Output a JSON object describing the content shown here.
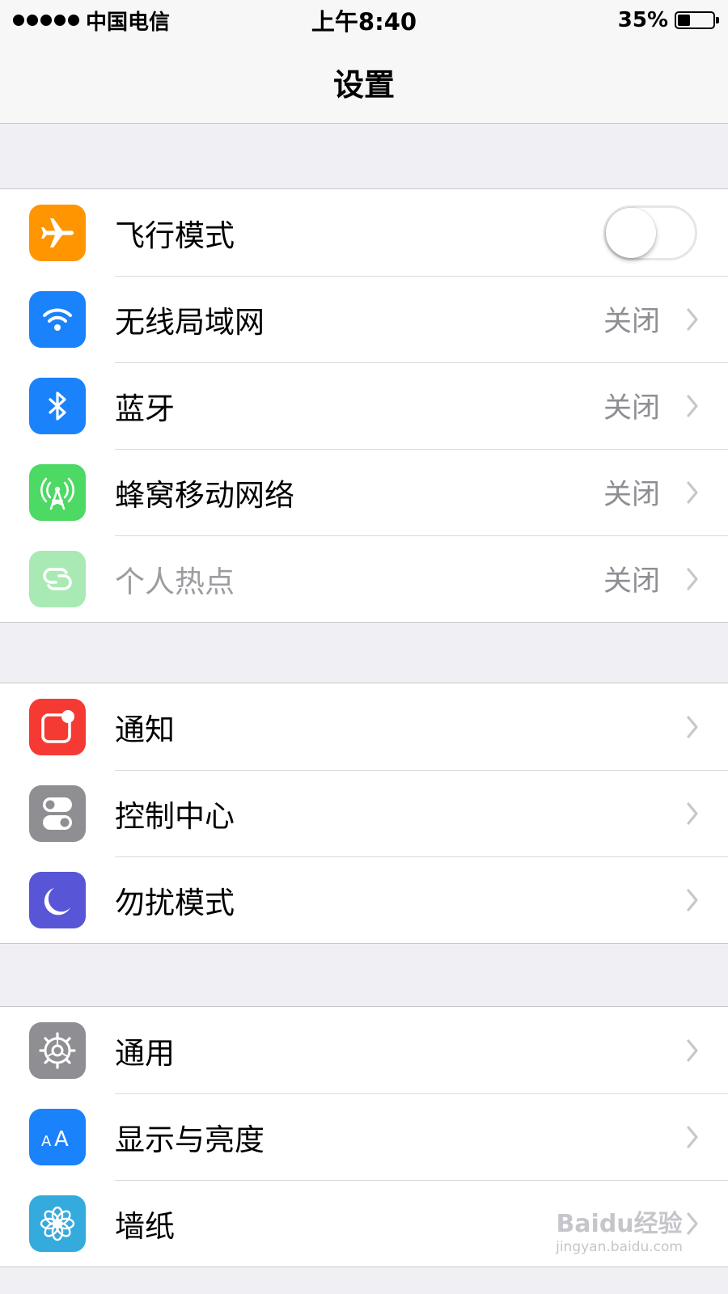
{
  "status_bar": {
    "carrier": "中国电信",
    "time": "上午8:40",
    "battery_percent_text": "35%",
    "battery_level": 0.35
  },
  "nav": {
    "title": "设置"
  },
  "sections": [
    {
      "rows": [
        {
          "label": "飞行模式",
          "icon": "airplane-icon",
          "icon_color": "#ff9500",
          "toggle": true,
          "toggle_on": false
        },
        {
          "label": "无线局域网",
          "icon": "wifi-icon",
          "icon_color": "#1a82fb",
          "detail": "关闭"
        },
        {
          "label": "蓝牙",
          "icon": "bluetooth-icon",
          "icon_color": "#1a82fb",
          "detail": "关闭"
        },
        {
          "label": "蜂窝移动网络",
          "icon": "cellular-antenna-icon",
          "icon_color": "#4cd964",
          "detail": "关闭"
        },
        {
          "label": "个人热点",
          "icon": "hotspot-chain-icon",
          "icon_color": "#a9e9b4",
          "detail": "关闭",
          "disabled": true
        }
      ]
    },
    {
      "rows": [
        {
          "label": "通知",
          "icon": "notifications-icon",
          "icon_color": "#f43a33"
        },
        {
          "label": "控制中心",
          "icon": "control-center-icon",
          "icon_color": "#8e8e93"
        },
        {
          "label": "勿扰模式",
          "icon": "moon-icon",
          "icon_color": "#5856d6"
        }
      ]
    },
    {
      "rows": [
        {
          "label": "通用",
          "icon": "gear-icon",
          "icon_color": "#8e8e93"
        },
        {
          "label": "显示与亮度",
          "icon": "text-size-icon",
          "icon_color": "#1a82fb"
        },
        {
          "label": "墙纸",
          "icon": "flower-icon",
          "icon_color": "#35aadc"
        }
      ]
    }
  ],
  "watermark": {
    "text": "Baidu经验",
    "sub": "jingyan.baidu.com"
  }
}
